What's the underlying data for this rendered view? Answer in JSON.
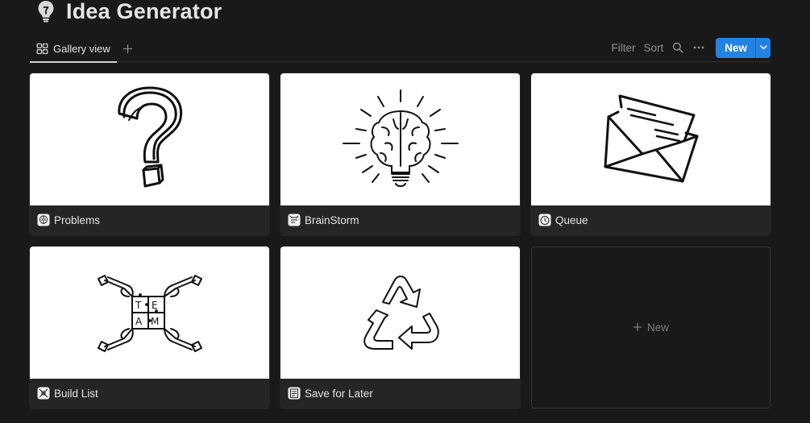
{
  "page": {
    "title": "Idea Generator",
    "title_icon": "lightbulb-icon"
  },
  "toolbar": {
    "view_tab_label": "Gallery view",
    "view_tab_icon": "gallery-grid-icon",
    "add_view_icon": "plus-icon",
    "filter_label": "Filter",
    "sort_label": "Sort",
    "search_icon": "search-icon",
    "more_icon": "more-horizontal-icon",
    "new_label": "New",
    "new_dropdown_icon": "chevron-down-icon"
  },
  "colors": {
    "background": "#191919",
    "card": "#252525",
    "accent": "#2383e2",
    "cover": "#ffffff"
  },
  "cards": [
    {
      "title": "Problems",
      "cover": "question-mark-illustration",
      "icon": "brain-icon"
    },
    {
      "title": "BrainStorm",
      "cover": "brain-lightbulb-illustration",
      "icon": "brain-storm-icon"
    },
    {
      "title": "Queue",
      "cover": "envelope-illustration",
      "icon": "clock-icon"
    },
    {
      "title": "Build List",
      "cover": "team-puzzle-illustration",
      "icon": "puzzle-icon"
    },
    {
      "title": "Save for Later",
      "cover": "recycle-illustration",
      "icon": "notepad-icon"
    }
  ],
  "new_card": {
    "label": "New",
    "icon": "plus-icon"
  }
}
